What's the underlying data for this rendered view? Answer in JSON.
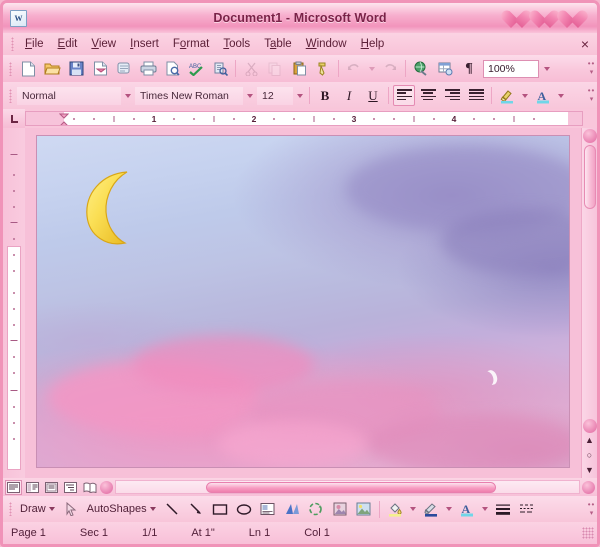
{
  "window": {
    "title": "Document1 - Microsoft Word",
    "app_icon": "word-icon",
    "buttons": [
      {
        "name": "minimize-button",
        "icon": "heart-icon"
      },
      {
        "name": "maximize-button",
        "icon": "heart-icon"
      },
      {
        "name": "close-button",
        "icon": "heart-icon"
      }
    ],
    "accent_pink": "#f294bc",
    "title_color": "#7a2248"
  },
  "menubar": {
    "items": [
      {
        "label": "File",
        "accel": "F"
      },
      {
        "label": "Edit",
        "accel": "E"
      },
      {
        "label": "View",
        "accel": "V"
      },
      {
        "label": "Insert",
        "accel": "I"
      },
      {
        "label": "Format",
        "accel": "o"
      },
      {
        "label": "Tools",
        "accel": "T"
      },
      {
        "label": "Table",
        "accel": "a"
      },
      {
        "label": "Window",
        "accel": "W"
      },
      {
        "label": "Help",
        "accel": "H"
      }
    ],
    "close_label": "×"
  },
  "standard_toolbar": {
    "buttons": [
      "new-document-icon",
      "open-folder-icon",
      "save-icon",
      "email-icon",
      "search-icon",
      "print-icon",
      "print-preview-icon",
      "spelling-grammar-icon",
      "research-icon",
      "cut-icon",
      "copy-icon",
      "paste-icon",
      "format-painter-icon",
      "undo-icon",
      "redo-icon",
      "insert-hyperlink-icon",
      "tables-borders-icon",
      "show-formatting-icon"
    ],
    "zoom_value": "100%"
  },
  "formatting_toolbar": {
    "style_value": "Normal",
    "font_value": "Times New Roman",
    "size_value": "12",
    "bold_label": "B",
    "italic_label": "I",
    "underline_label": "U",
    "buttons": [
      "align-left-icon",
      "align-center-icon",
      "align-right-icon",
      "justify-icon",
      "highlight-color-icon",
      "font-color-icon"
    ],
    "active_alignment": "align-left-icon"
  },
  "ruler": {
    "corner_label": "L",
    "h_ticks": [
      "1",
      "2",
      "3",
      "4"
    ],
    "unit": "inch"
  },
  "document": {
    "page_name": "document-page",
    "image_alt": "pastel-sky-with-crescent-moon",
    "moon_emoji": "crescent-moon",
    "sky_colors": {
      "blue": "#c2cdeb",
      "purple": "#b0a6d4",
      "pink_cloud": "#f095c3"
    }
  },
  "scrollbars": {
    "vertical": {
      "up_label": "▲",
      "down_label": "▼",
      "browse_prev": "⬆",
      "browse_select": "●",
      "browse_next": "⬇"
    },
    "horizontal": {
      "left_label": "◀",
      "right_label": "▶"
    }
  },
  "view_buttons": [
    {
      "name": "view-normal",
      "icon": "normal-view-icon",
      "active": true
    },
    {
      "name": "view-web-layout",
      "icon": "web-layout-icon",
      "active": false
    },
    {
      "name": "view-print-layout",
      "icon": "print-layout-icon",
      "active": false
    },
    {
      "name": "view-outline",
      "icon": "outline-view-icon",
      "active": false
    },
    {
      "name": "view-reading",
      "icon": "reading-layout-icon",
      "active": false
    }
  ],
  "drawing_toolbar": {
    "draw_label": "Draw",
    "autoshapes_label": "AutoShapes",
    "buttons": [
      "select-objects-icon",
      "line-icon",
      "arrow-icon",
      "rectangle-icon",
      "oval-icon",
      "text-box-icon",
      "wordart-icon",
      "diagram-icon",
      "clip-art-icon",
      "insert-picture-icon",
      "fill-color-icon",
      "line-color-icon",
      "font-color-icon",
      "line-style-icon",
      "dash-style-icon"
    ]
  },
  "statusbar": {
    "page": "Page 1",
    "section": "Sec 1",
    "pages": "1/1",
    "at": "At 1\"",
    "line": "Ln 1",
    "column": "Col 1"
  }
}
